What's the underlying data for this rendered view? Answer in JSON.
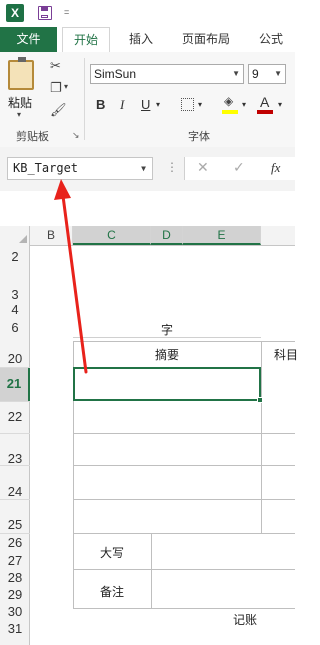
{
  "quick_access": {
    "app_logo": "X",
    "more": "="
  },
  "tabs": [
    "文件",
    "开始",
    "插入",
    "页面布局",
    "公式"
  ],
  "ribbon": {
    "paste_label": "粘贴",
    "clipboard_group": "剪贴板",
    "font_group": "字体",
    "font_name": "SimSun",
    "font_size": "9",
    "bold": "B",
    "italic": "I",
    "underline": "U",
    "font_color_letter": "A"
  },
  "formula_bar": {
    "name_box": "KB_Target",
    "dots": "⋮",
    "cancel": "✕",
    "enter": "✓",
    "fx": "fx",
    "formula": ""
  },
  "columns": [
    "B",
    "C",
    "D",
    "E"
  ],
  "rows": [
    "2",
    "3",
    "4",
    "6",
    "20",
    "21",
    "22",
    "23",
    "24",
    "25",
    "26",
    "27",
    "28",
    "29",
    "30",
    "31"
  ],
  "cells": {
    "zi": "字",
    "summary_header": "摘要",
    "subject_header": "科目",
    "daxie": "大写",
    "beizhu": "备注",
    "jizhang": "记账"
  },
  "annotation": {
    "color": "#e8221b",
    "target": "name-box"
  },
  "colors": {
    "accent": "#217346"
  }
}
